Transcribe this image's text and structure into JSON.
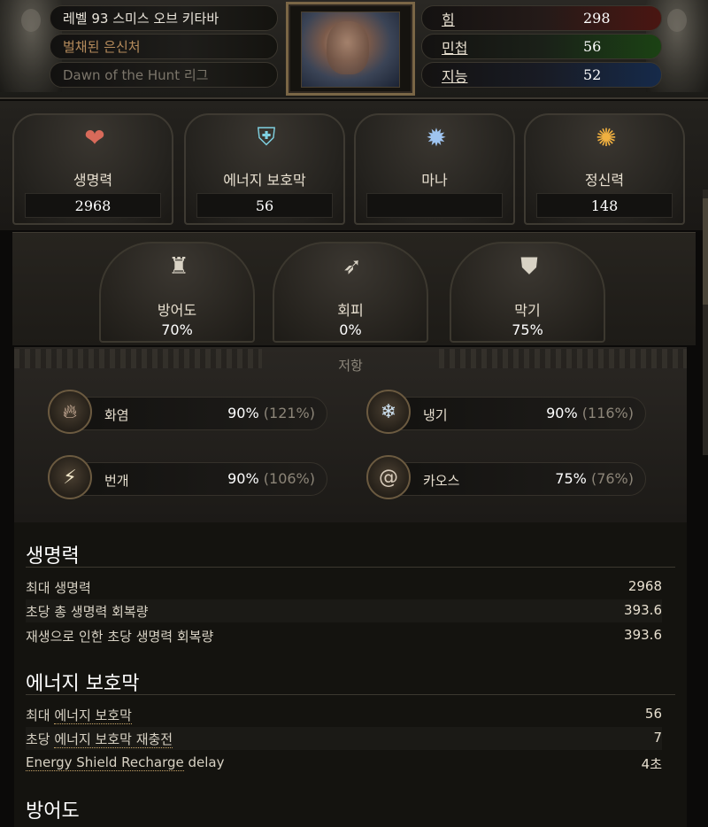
{
  "character": {
    "level_line": "레벨 93 스미스 오브 키타바",
    "class_line": "벌채된 은신처",
    "league_line": "Dawn of the Hunt 리그"
  },
  "attributes": [
    {
      "name": "힘",
      "value": "298",
      "color": "#4a1612"
    },
    {
      "name": "민첩",
      "value": "56",
      "color": "#1b4214"
    },
    {
      "name": "지능",
      "value": "52",
      "color": "#162a4a"
    }
  ],
  "pools": [
    {
      "name": "생명력",
      "value": "2968",
      "icon": "heart-icon"
    },
    {
      "name": "에너지 보호막",
      "value": "56",
      "icon": "shield-crest-icon"
    },
    {
      "name": "마나",
      "value": "",
      "icon": "mana-burst-icon"
    },
    {
      "name": "정신력",
      "value": "148",
      "icon": "spirit-orb-icon"
    }
  ],
  "defences": [
    {
      "name": "방어도",
      "value": "70%",
      "icon": "armour-icon"
    },
    {
      "name": "회피",
      "value": "0%",
      "icon": "evasion-icon"
    },
    {
      "name": "막기",
      "value": "75%",
      "icon": "block-shield-icon"
    }
  ],
  "resistances": {
    "title": "저항",
    "items": [
      {
        "name": "화염",
        "value": "90%",
        "max": "(121%)",
        "icon": "fire-icon"
      },
      {
        "name": "냉기",
        "value": "90%",
        "max": "(116%)",
        "icon": "snowflake-icon"
      },
      {
        "name": "번개",
        "value": "90%",
        "max": "(106%)",
        "icon": "lightning-icon"
      },
      {
        "name": "카오스",
        "value": "75%",
        "max": "(76%)",
        "icon": "spiral-icon"
      }
    ]
  },
  "sections": [
    {
      "title": "생명력",
      "rows": [
        {
          "label": "최대 생명력",
          "value": "2968"
        },
        {
          "label": "초당 총 생명력 회복량",
          "value": "393.6"
        },
        {
          "label": "재생으로 인한 초당 생명력 회복량",
          "value": "393.6"
        }
      ]
    },
    {
      "title": "에너지 보호막",
      "rows": [
        {
          "label_prefix": "최대 ",
          "label_link": "에너지 보호막",
          "value": "56"
        },
        {
          "label_prefix": "초당 ",
          "label_link": "에너지 보호막 재충전",
          "value": "7"
        },
        {
          "label_link": "Energy Shield Recharge",
          "label_suffix": " delay",
          "value": "4초"
        }
      ]
    },
    {
      "title": "방어도"
    }
  ]
}
